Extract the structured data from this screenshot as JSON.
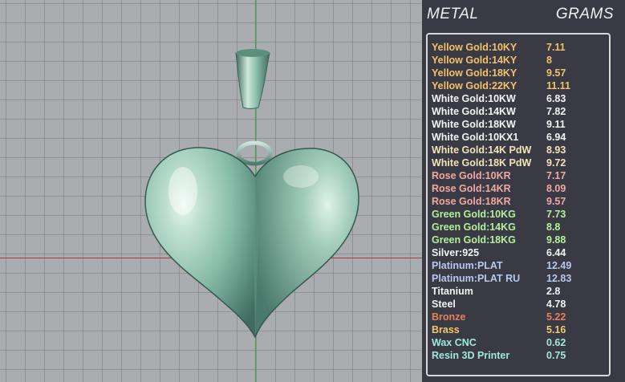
{
  "panel": {
    "metal_header": "METAL",
    "grams_header": "GRAMS",
    "rows": [
      {
        "name": "Yellow Gold:10KY",
        "value": "7.11",
        "color": "#f2c26a"
      },
      {
        "name": "Yellow Gold:14KY",
        "value": "8",
        "color": "#f2c26a"
      },
      {
        "name": "Yellow Gold:18KY",
        "value": "9.57",
        "color": "#f2c26a"
      },
      {
        "name": "Yellow Gold:22KY",
        "value": "11.11",
        "color": "#f2c26a"
      },
      {
        "name": "White Gold:10KW",
        "value": "6.83",
        "color": "#f4f4f4"
      },
      {
        "name": "White Gold:14KW",
        "value": "7.82",
        "color": "#f4f4f4"
      },
      {
        "name": "White Gold:18KW",
        "value": "9.11",
        "color": "#f4f4f4"
      },
      {
        "name": "White Gold:10KX1",
        "value": "6.94",
        "color": "#f4f4f4"
      },
      {
        "name": "White Gold:14K PdW",
        "value": "8.93",
        "color": "#f3e3b8"
      },
      {
        "name": "White Gold:18K PdW",
        "value": "9.72",
        "color": "#f3e3b8"
      },
      {
        "name": "Rose Gold:10KR",
        "value": "7.17",
        "color": "#f0a8a2"
      },
      {
        "name": "Rose Gold:14KR",
        "value": "8.09",
        "color": "#f0a8a2"
      },
      {
        "name": "Rose Gold:18KR",
        "value": "9.57",
        "color": "#f0a8a2"
      },
      {
        "name": "Green Gold:10KG",
        "value": "7.73",
        "color": "#b6ef9a"
      },
      {
        "name": "Green Gold:14KG",
        "value": "8.8",
        "color": "#b6ef9a"
      },
      {
        "name": "Green Gold:18KG",
        "value": "9.88",
        "color": "#b6ef9a"
      },
      {
        "name": "Silver:925",
        "value": "6.44",
        "color": "#f4f4f4"
      },
      {
        "name": "Platinum:PLAT",
        "value": "12.49",
        "color": "#b8c8ee"
      },
      {
        "name": "Platinum:PLAT RU",
        "value": "12.83",
        "color": "#b8c8ee"
      },
      {
        "name": "Titanium",
        "value": "2.8",
        "color": "#f4f4f4"
      },
      {
        "name": "Steel",
        "value": "4.78",
        "color": "#f4f4f4"
      },
      {
        "name": "Bronze",
        "value": "5.22",
        "color": "#e8805a"
      },
      {
        "name": "Brass",
        "value": "5.16",
        "color": "#f2c86a"
      },
      {
        "name": "Wax  CNC",
        "value": "0.62",
        "color": "#9ee8e0"
      },
      {
        "name": "Resin 3D Printer",
        "value": "0.75",
        "color": "#9ee8e0"
      }
    ]
  },
  "colors": {
    "model": "#7fb0a0",
    "panel_bg": "#3a3a44",
    "grid_bg": "#a9adaf",
    "axis_x": "#b03a3a",
    "axis_y": "#3aa83a"
  }
}
